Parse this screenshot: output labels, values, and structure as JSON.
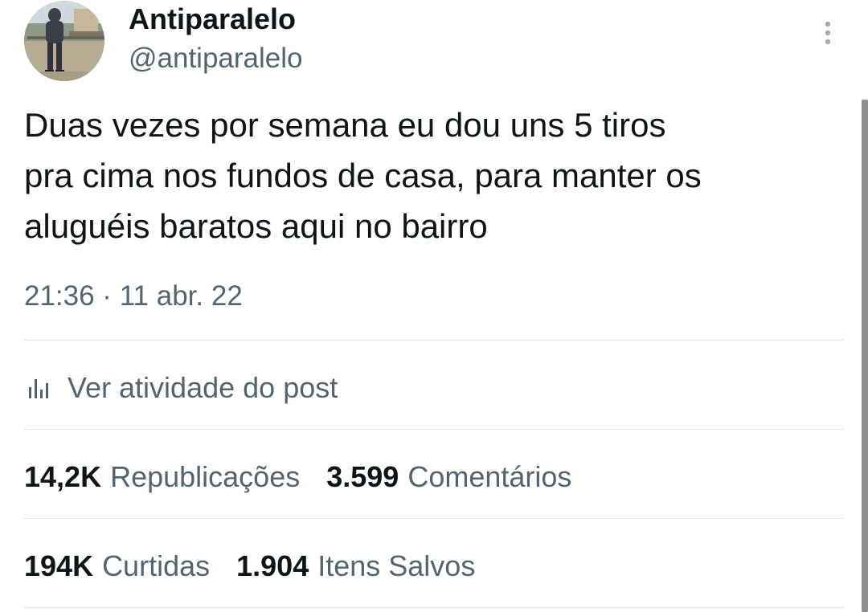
{
  "author": {
    "display_name": "Antiparalelo",
    "handle": "@antiparalelo",
    "avatar_icon": "profile-photo-person-outdoors"
  },
  "more_icon": "vertical-ellipsis-icon",
  "tweet": {
    "text": "Duas vezes por semana eu dou uns 5 tiros\npra cima nos fundos de casa, para manter os\naluguéis baratos aqui no bairro",
    "timestamp": "21:36 · 11 abr. 22"
  },
  "activity": {
    "icon": "bar-chart-icon",
    "label": "Ver atividade do post"
  },
  "stats": {
    "reposts": {
      "count": "14,2K",
      "label": "Republicações"
    },
    "quotes": {
      "count": "3.599",
      "label": "Comentários"
    },
    "likes": {
      "count": "194K",
      "label": "Curtidas"
    },
    "bookmarks": {
      "count": "1.904",
      "label": "Itens Salvos"
    }
  },
  "colors": {
    "primary_text": "#0f1419",
    "secondary_text": "#536471",
    "divider": "#e1e5e8"
  }
}
